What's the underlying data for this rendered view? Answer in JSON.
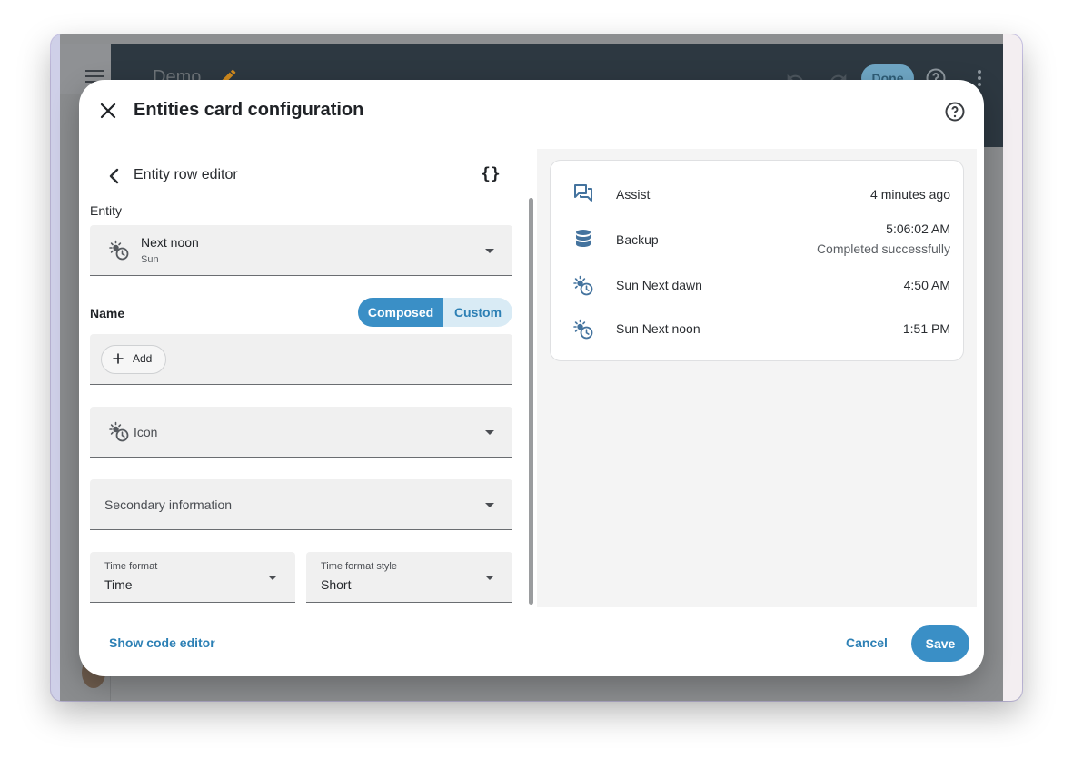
{
  "app": {
    "title": "Demo",
    "done_label": "Done"
  },
  "dialog": {
    "title": "Entities card configuration",
    "row_editor_title": "Entity row editor",
    "code_toggle": "{}",
    "entity_label": "Entity",
    "entity": {
      "name": "Next noon",
      "domain": "Sun"
    },
    "name_label": "Name",
    "name_modes": {
      "composed": "Composed",
      "custom": "Custom",
      "selected": "Composed"
    },
    "add_label": "Add",
    "icon_placeholder": "Icon",
    "secondary_placeholder": "Secondary information",
    "time_format": {
      "label": "Time format",
      "value": "Time"
    },
    "time_format_style": {
      "label": "Time format style",
      "value": "Short"
    },
    "show_code_editor": "Show code editor",
    "cancel": "Cancel",
    "save": "Save"
  },
  "preview": {
    "rows": [
      {
        "icon": "chat-bubbles-icon",
        "name": "Assist",
        "value": "4 minutes ago"
      },
      {
        "icon": "database-icon",
        "name": "Backup",
        "value": "5:06:02 AM",
        "secondary": "Completed successfully"
      },
      {
        "icon": "sun-clock-icon",
        "name": "Sun Next dawn",
        "value": "4:50 AM"
      },
      {
        "icon": "sun-clock-icon",
        "name": "Sun Next noon",
        "value": "1:51 PM"
      }
    ]
  },
  "colors": {
    "primary": "#3a8fc6",
    "primary_light": "#d9ebf5",
    "topbar": "#2d3841",
    "icon_blue": "#44739e"
  }
}
